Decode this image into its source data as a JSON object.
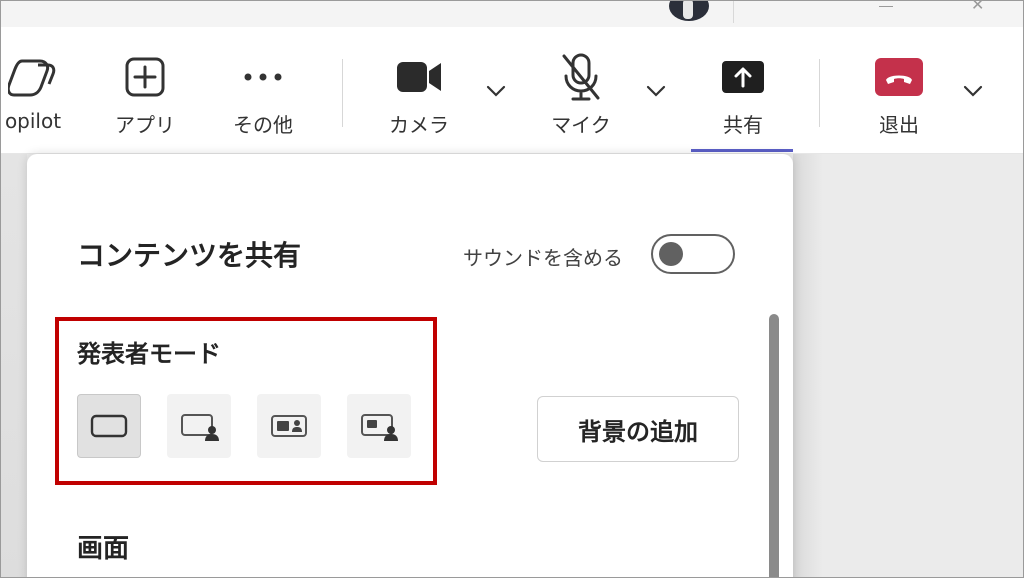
{
  "toolbar": {
    "copilot_label": "opilot",
    "apps_label": "アプリ",
    "more_label": "その他",
    "camera_label": "カメラ",
    "mic_label": "マイク",
    "share_label": "共有",
    "leave_label": "退出"
  },
  "panel": {
    "title": "コンテンツを共有",
    "sound_label": "サウンドを含める",
    "sound_on": false,
    "presenter_mode_title": "発表者モード",
    "presenter_modes": [
      "content-only",
      "standout",
      "side-by-side",
      "reporter"
    ],
    "add_background_label": "背景の追加",
    "screen_title": "画面"
  },
  "colors": {
    "leave": "#c4314b",
    "share_accent": "#5b5fc7",
    "highlight_box": "#c00000"
  }
}
